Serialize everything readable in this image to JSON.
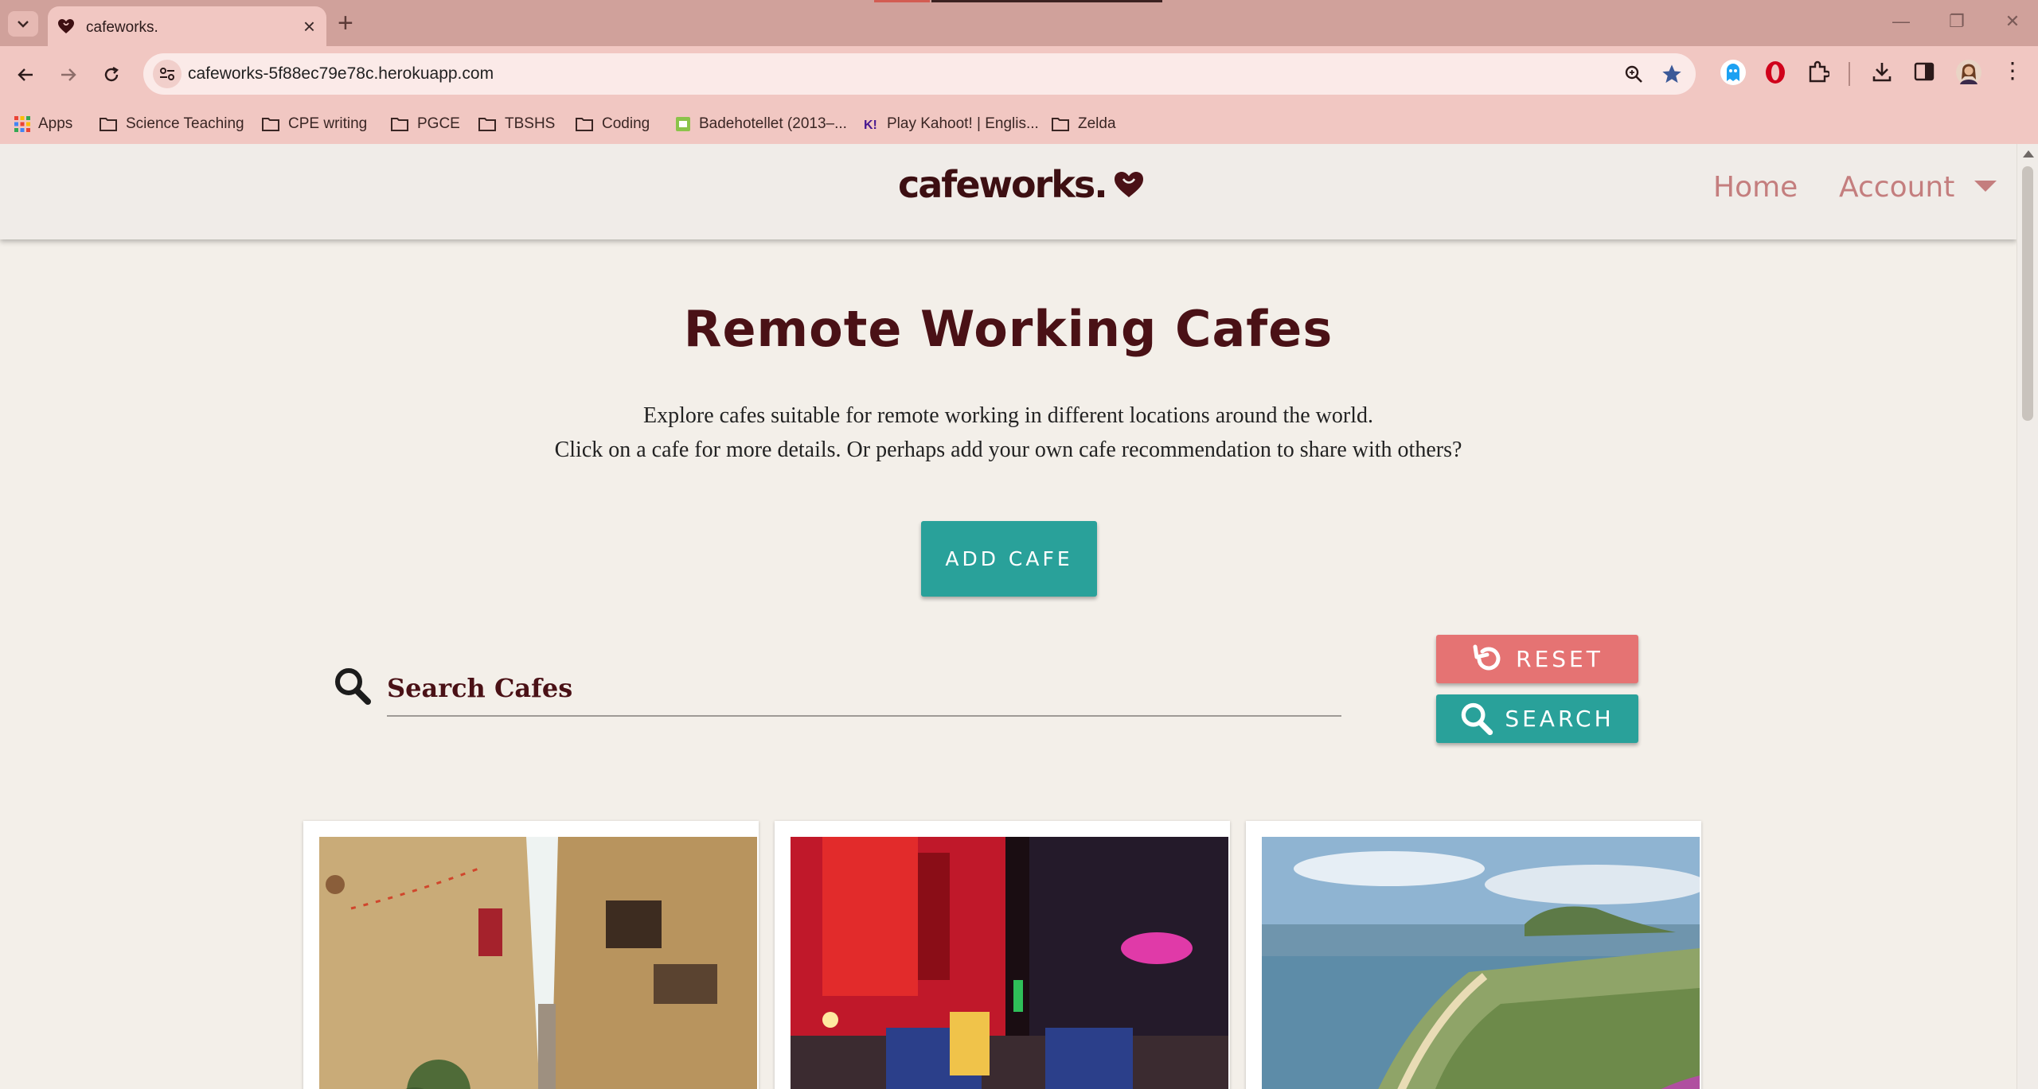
{
  "browser": {
    "tab_title": "cafeworks.",
    "url": "cafeworks-5f88ec79e78c.herokuapp.com",
    "bookmarks": [
      {
        "label": "Apps",
        "icon": "apps-grid-icon"
      },
      {
        "label": "Science Teaching",
        "icon": "folder-icon"
      },
      {
        "label": "CPE writing",
        "icon": "folder-icon"
      },
      {
        "label": "PGCE",
        "icon": "folder-icon"
      },
      {
        "label": "TBSHS",
        "icon": "folder-icon"
      },
      {
        "label": "Coding",
        "icon": "folder-icon"
      },
      {
        "label": "Badehotellet (2013–...",
        "icon": "video-favicon"
      },
      {
        "label": "Play Kahoot! | Englis...",
        "icon": "kahoot-favicon"
      },
      {
        "label": "Zelda",
        "icon": "folder-icon"
      }
    ]
  },
  "site": {
    "logo_text": "cafeworks.",
    "nav": {
      "home": "Home",
      "account": "Account"
    }
  },
  "main": {
    "title": "Remote Working Cafes",
    "intro_line1": "Explore cafes suitable for remote working in different locations around the world.",
    "intro_line2": "Click on a cafe for more details. Or perhaps add your own cafe recommendation to share with others?",
    "add_button": "ADD CAFE",
    "search_placeholder": "Search Cafes",
    "reset_button": "RESET",
    "search_button": "SEARCH"
  },
  "cards": [
    {
      "image": "narrow old-town street with sandstone buildings and balconies"
    },
    {
      "image": "neon-lit city street at night with tuk-tuks"
    },
    {
      "image": "coastal bay with beach, town and hills"
    }
  ],
  "colors": {
    "accent_teal": "#29a19a",
    "reset_red": "#e57373",
    "brand_dark": "#4a1116",
    "nav_pink": "#c47e7e"
  }
}
